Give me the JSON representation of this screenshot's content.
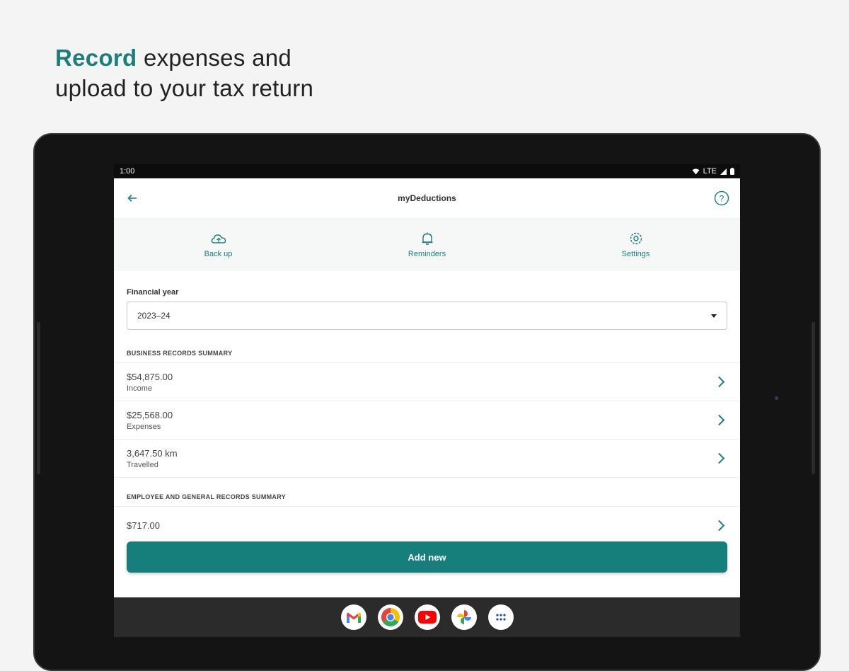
{
  "headline": {
    "accent": "Record",
    "rest_line1": " expenses and",
    "line2": "upload to your tax return"
  },
  "status": {
    "time": "1:00",
    "network": "LTE"
  },
  "appbar": {
    "title": "myDeductions"
  },
  "quick_actions": [
    {
      "label": "Back up",
      "icon": "backup-icon"
    },
    {
      "label": "Reminders",
      "icon": "bell-icon"
    },
    {
      "label": "Settings",
      "icon": "gear-icon"
    }
  ],
  "financial_year": {
    "label": "Financial year",
    "value": "2023–24"
  },
  "business": {
    "heading": "BUSINESS RECORDS SUMMARY",
    "rows": [
      {
        "amount": "$54,875.00",
        "label": "Income"
      },
      {
        "amount": "$25,568.00",
        "label": "Expenses"
      },
      {
        "amount": "3,647.50 km",
        "label": "Travelled"
      }
    ]
  },
  "employee": {
    "heading": "EMPLOYEE AND GENERAL RECORDS SUMMARY",
    "rows": [
      {
        "amount": "$717.00"
      }
    ]
  },
  "add_button": "Add new",
  "dock": [
    "gmail-icon",
    "chrome-icon",
    "youtube-icon",
    "photos-icon",
    "app-drawer-icon"
  ],
  "colors": {
    "accent": "#1a7f7b",
    "button": "#177f7b"
  }
}
